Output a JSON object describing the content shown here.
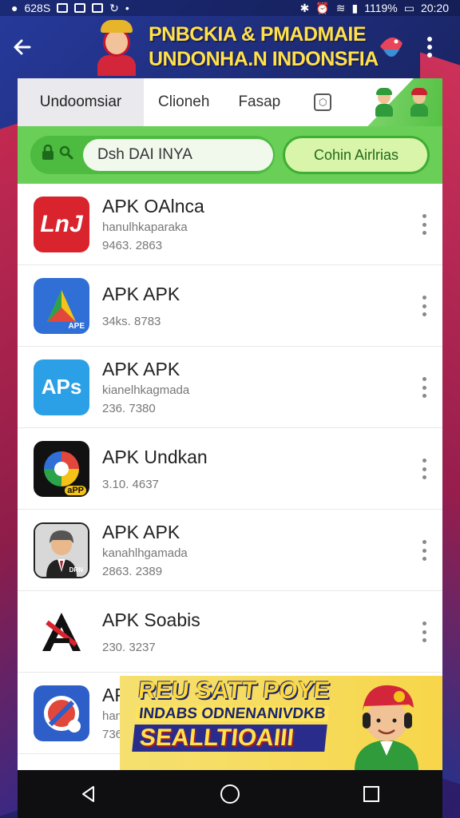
{
  "status_bar": {
    "left_text": "628S",
    "battery": "1119%",
    "time": "20:20"
  },
  "header": {
    "title_line1": "PNBCKIA & PMADMAIE",
    "title_line2": "UNDONHA.N INDONSFIA"
  },
  "tabs": [
    {
      "label": "Undoomsiar"
    },
    {
      "label": "Clioneh"
    },
    {
      "label": "Fasap"
    }
  ],
  "search": {
    "value": "Dsh DAI INYA",
    "button_label": "Cohin Airlrias"
  },
  "apps": [
    {
      "name": "APK OAlnca",
      "sub": "hanulhkaparaka",
      "meta": "9463. 2863",
      "icon": "lnl-app-icon",
      "icon_text": "LnJ"
    },
    {
      "name": "APK APK",
      "sub": "",
      "meta": "34ks. 8783",
      "icon": "triangle-app-icon",
      "icon_text": "APE"
    },
    {
      "name": "APK APK",
      "sub": "kianelhkagmada",
      "meta": "236. 7380",
      "icon": "aps-chat-app-icon",
      "icon_text": "APs"
    },
    {
      "name": "APK Undkan",
      "sub": "",
      "meta": "3.10. 4637",
      "icon": "color-ring-app-icon",
      "icon_text": "aPP"
    },
    {
      "name": "APK APK",
      "sub": "kanahlhgamada",
      "meta": "2863. 2389",
      "icon": "avatar-man-app-icon",
      "icon_text": "DRN"
    },
    {
      "name": "APK Soabis",
      "sub": "",
      "meta": "230. 3237",
      "icon": "a-logo-app-icon",
      "icon_text": ""
    },
    {
      "name": "APK",
      "sub": "hanan",
      "meta": "736. 68",
      "icon": "shield-app-icon",
      "icon_text": ""
    }
  ],
  "promo": {
    "line1": "REU SATT POYE",
    "line2": "INDABS ODNENANIVDKB",
    "line3": "SEALLTIOAIII"
  },
  "colors": {
    "accent_green": "#69cf57",
    "banner_yellow": "#ffe14a",
    "bg_navy": "#1c2a6e",
    "accent_red": "#d6284a"
  }
}
